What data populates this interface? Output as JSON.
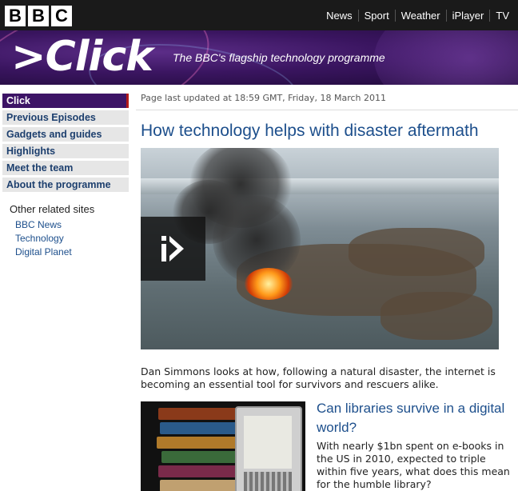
{
  "header": {
    "logo_letters": [
      "B",
      "B",
      "C"
    ],
    "nav": [
      "News",
      "Sport",
      "Weather",
      "iPlayer",
      "TV"
    ]
  },
  "banner": {
    "brand": ">Click",
    "tagline": "The BBC's flagship technology programme"
  },
  "sidebar": {
    "items": [
      {
        "label": "Click",
        "active": true
      },
      {
        "label": "Previous Episodes",
        "active": false
      },
      {
        "label": "Gadgets and guides",
        "active": false
      },
      {
        "label": "Highlights",
        "active": false
      },
      {
        "label": "Meet the team",
        "active": false
      },
      {
        "label": "About the programme",
        "active": false
      }
    ],
    "related_title": "Other related sites",
    "related_links": [
      "BBC News",
      "Technology",
      "Digital Planet"
    ]
  },
  "main": {
    "updated": "Page last updated at 18:59 GMT, Friday, 18 March 2011",
    "headline": "How technology helps with disaster aftermath",
    "description": "Dan Simmons looks at how, following a natural disaster, the internet is becoming an essential tool for survivors and rescuers alike.",
    "story": {
      "title": "Can libraries survive in a digital world?",
      "text": "With nearly $1bn spent on e-books in the US in 2010, expected to triple within five years, what does this mean for the humble library?"
    }
  },
  "colors": {
    "link": "#1d4f8c",
    "active_nav": "#3d1466",
    "active_marker": "#b21a1a",
    "topbar": "#1a1a1a"
  }
}
